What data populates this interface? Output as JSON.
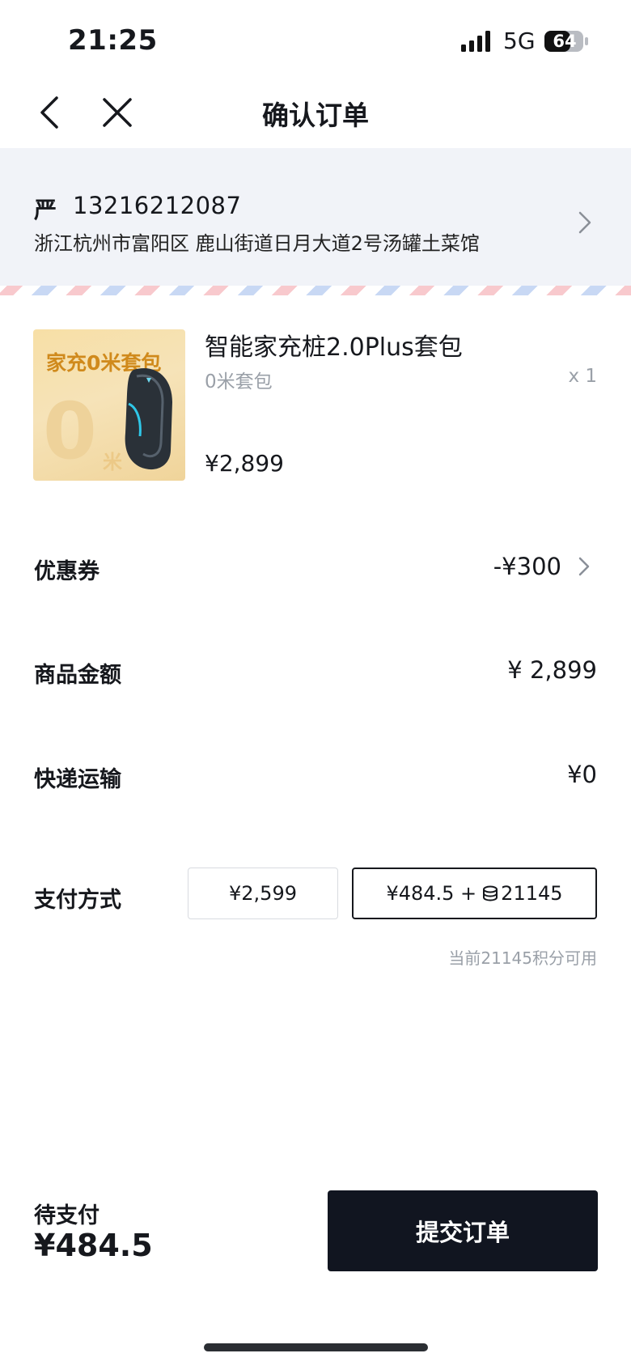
{
  "status_bar": {
    "time": "21:25",
    "network": "5G",
    "battery": "64"
  },
  "nav": {
    "title": "确认订单"
  },
  "address": {
    "name": "严",
    "phone": "13216212087",
    "detail": "浙江杭州市富阳区  鹿山街道日月大道2号汤罐土菜馆"
  },
  "product": {
    "image_banner": "家充0米套包",
    "image_big": "0",
    "image_unit": "米",
    "name": "智能家充桩2.0Plus套包",
    "spec": "0米套包",
    "qty": "x 1",
    "price": "¥2,899"
  },
  "rows": {
    "coupon": {
      "label": "优惠券",
      "value": "-¥300"
    },
    "goods": {
      "label": "商品金额",
      "value": "¥ 2,899"
    },
    "shipping": {
      "label": "快递运输",
      "value": "¥0"
    }
  },
  "payment": {
    "label": "支付方式",
    "option1": "¥2,599",
    "option2_cash": "¥484.5 +",
    "option2_points": "21145",
    "selected": "option2",
    "points_note": "当前21145积分可用"
  },
  "bottom": {
    "due_label": "待支付",
    "due_amount": "¥484.5",
    "submit_label": "提交订单"
  },
  "colors": {
    "accent": "#111520",
    "address_bg": "#f1f3f8",
    "muted": "#9aa0a8"
  }
}
